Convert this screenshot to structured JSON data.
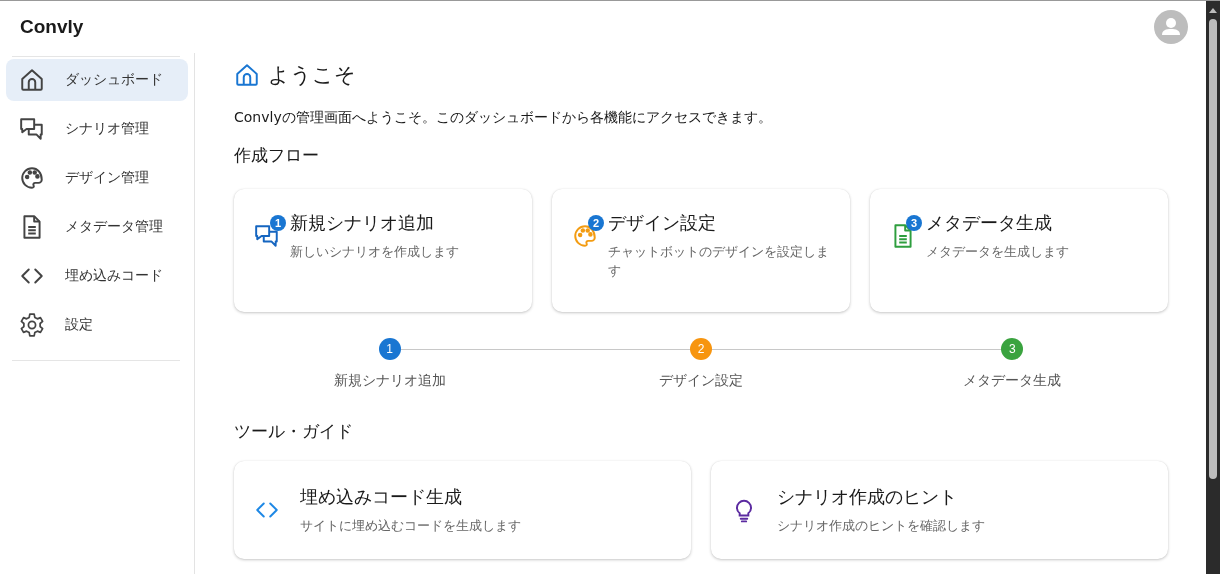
{
  "app": {
    "title": "Convly"
  },
  "sidebar": {
    "items": [
      {
        "label": "ダッシュボード",
        "kind": "home",
        "selected": true
      },
      {
        "label": "シナリオ管理",
        "kind": "chat",
        "selected": false
      },
      {
        "label": "デザイン管理",
        "kind": "palette",
        "selected": false
      },
      {
        "label": "メタデータ管理",
        "kind": "document",
        "selected": false
      },
      {
        "label": "埋め込みコード",
        "kind": "code",
        "selected": false
      },
      {
        "label": "設定",
        "kind": "gear",
        "selected": false
      }
    ]
  },
  "page": {
    "title": "ようこそ",
    "intro": "Convlyの管理画面へようこそ。このダッシュボードから各機能にアクセスできます。"
  },
  "flow": {
    "heading": "作成フロー",
    "cards": [
      {
        "badge": "1",
        "title": "新規シナリオ追加",
        "description": "新しいシナリオを作成します",
        "kind": "chat",
        "color": "#1565c0"
      },
      {
        "badge": "2",
        "title": "デザイン設定",
        "description": "チャットボットのデザインを設定します",
        "kind": "palette",
        "color": "#f39c12"
      },
      {
        "badge": "3",
        "title": "メタデータ生成",
        "description": "メタデータを生成します",
        "kind": "document",
        "color": "#2e9e3e"
      }
    ],
    "steps": [
      {
        "number": "1",
        "label": "新規シナリオ追加",
        "color": "#1976d2"
      },
      {
        "number": "2",
        "label": "デザイン設定",
        "color": "#f7950f"
      },
      {
        "number": "3",
        "label": "メタデータ生成",
        "color": "#3aa33f"
      }
    ]
  },
  "tools": {
    "heading": "ツール・ガイド",
    "cards": [
      {
        "title": "埋め込みコード生成",
        "description": "サイトに埋め込むコードを生成します",
        "kind": "code",
        "color": "#1e88e5"
      },
      {
        "title": "シナリオ作成のヒント",
        "description": "シナリオ作成のヒントを確認します",
        "kind": "bulb",
        "color": "#5b2aa0"
      }
    ]
  }
}
